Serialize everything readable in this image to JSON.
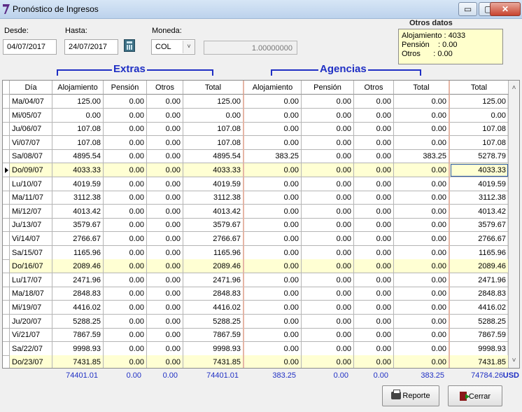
{
  "window": {
    "title": "Pronóstico de Ingresos",
    "min_glyph": "▭",
    "max_glyph": "▢",
    "close_glyph": "✕"
  },
  "filters": {
    "desde_label": "Desde:",
    "desde_value": "04/07/2017",
    "hasta_label": "Hasta:",
    "hasta_value": "24/07/2017",
    "moneda_label": "Moneda:",
    "moneda_value": "COL",
    "tasa_value": "1.00000000"
  },
  "otros_datos": {
    "title": "Otros datos",
    "lines": [
      "Alojamiento : 4033",
      "Pensión    : 0.00",
      "Otros      : 0.00"
    ]
  },
  "groups": {
    "extras": "Extras",
    "agencias": "Agencias"
  },
  "columns": [
    "Día",
    "Alojamiento",
    "Pensión",
    "Otros",
    "Total",
    "Alojamiento",
    "Pensión",
    "Otros",
    "Total",
    "Total"
  ],
  "rows": [
    [
      "Ma/04/07",
      "125.00",
      "0.00",
      "0.00",
      "125.00",
      "0.00",
      "0.00",
      "0.00",
      "0.00",
      "125.00"
    ],
    [
      "Mi/05/07",
      "0.00",
      "0.00",
      "0.00",
      "0.00",
      "0.00",
      "0.00",
      "0.00",
      "0.00",
      "0.00"
    ],
    [
      "Ju/06/07",
      "107.08",
      "0.00",
      "0.00",
      "107.08",
      "0.00",
      "0.00",
      "0.00",
      "0.00",
      "107.08"
    ],
    [
      "Vi/07/07",
      "107.08",
      "0.00",
      "0.00",
      "107.08",
      "0.00",
      "0.00",
      "0.00",
      "0.00",
      "107.08"
    ],
    [
      "Sa/08/07",
      "4895.54",
      "0.00",
      "0.00",
      "4895.54",
      "383.25",
      "0.00",
      "0.00",
      "383.25",
      "5278.79"
    ],
    [
      "Do/09/07",
      "4033.33",
      "0.00",
      "0.00",
      "4033.33",
      "0.00",
      "0.00",
      "0.00",
      "0.00",
      "4033.33"
    ],
    [
      "Lu/10/07",
      "4019.59",
      "0.00",
      "0.00",
      "4019.59",
      "0.00",
      "0.00",
      "0.00",
      "0.00",
      "4019.59"
    ],
    [
      "Ma/11/07",
      "3112.38",
      "0.00",
      "0.00",
      "3112.38",
      "0.00",
      "0.00",
      "0.00",
      "0.00",
      "3112.38"
    ],
    [
      "Mi/12/07",
      "4013.42",
      "0.00",
      "0.00",
      "4013.42",
      "0.00",
      "0.00",
      "0.00",
      "0.00",
      "4013.42"
    ],
    [
      "Ju/13/07",
      "3579.67",
      "0.00",
      "0.00",
      "3579.67",
      "0.00",
      "0.00",
      "0.00",
      "0.00",
      "3579.67"
    ],
    [
      "Vi/14/07",
      "2766.67",
      "0.00",
      "0.00",
      "2766.67",
      "0.00",
      "0.00",
      "0.00",
      "0.00",
      "2766.67"
    ],
    [
      "Sa/15/07",
      "1165.96",
      "0.00",
      "0.00",
      "1165.96",
      "0.00",
      "0.00",
      "0.00",
      "0.00",
      "1165.96"
    ],
    [
      "Do/16/07",
      "2089.46",
      "0.00",
      "0.00",
      "2089.46",
      "0.00",
      "0.00",
      "0.00",
      "0.00",
      "2089.46"
    ],
    [
      "Lu/17/07",
      "2471.96",
      "0.00",
      "0.00",
      "2471.96",
      "0.00",
      "0.00",
      "0.00",
      "0.00",
      "2471.96"
    ],
    [
      "Ma/18/07",
      "2848.83",
      "0.00",
      "0.00",
      "2848.83",
      "0.00",
      "0.00",
      "0.00",
      "0.00",
      "2848.83"
    ],
    [
      "Mi/19/07",
      "4416.02",
      "0.00",
      "0.00",
      "4416.02",
      "0.00",
      "0.00",
      "0.00",
      "0.00",
      "4416.02"
    ],
    [
      "Ju/20/07",
      "5288.25",
      "0.00",
      "0.00",
      "5288.25",
      "0.00",
      "0.00",
      "0.00",
      "0.00",
      "5288.25"
    ],
    [
      "Vi/21/07",
      "7867.59",
      "0.00",
      "0.00",
      "7867.59",
      "0.00",
      "0.00",
      "0.00",
      "0.00",
      "7867.59"
    ],
    [
      "Sa/22/07",
      "9998.93",
      "0.00",
      "0.00",
      "9998.93",
      "0.00",
      "0.00",
      "0.00",
      "0.00",
      "9998.93"
    ],
    [
      "Do/23/07",
      "7431.85",
      "0.00",
      "0.00",
      "7431.85",
      "0.00",
      "0.00",
      "0.00",
      "0.00",
      "7431.85"
    ]
  ],
  "highlighted_rows": [
    5,
    12,
    19
  ],
  "current_row": 5,
  "totals": [
    "74401.01",
    "0.00",
    "0.00",
    "74401.01",
    "383.25",
    "0.00",
    "0.00",
    "383.25",
    "74784.26"
  ],
  "currency": "USD",
  "buttons": {
    "reporte": "Reporte",
    "cerrar": "Cerrar"
  },
  "scroll": {
    "up": "˄",
    "down": "˅",
    "combo": "˅"
  },
  "colors": {
    "accent": "#1f2fc4",
    "row_highlight": "#ffffd3",
    "info_box": "#ffffcc"
  }
}
